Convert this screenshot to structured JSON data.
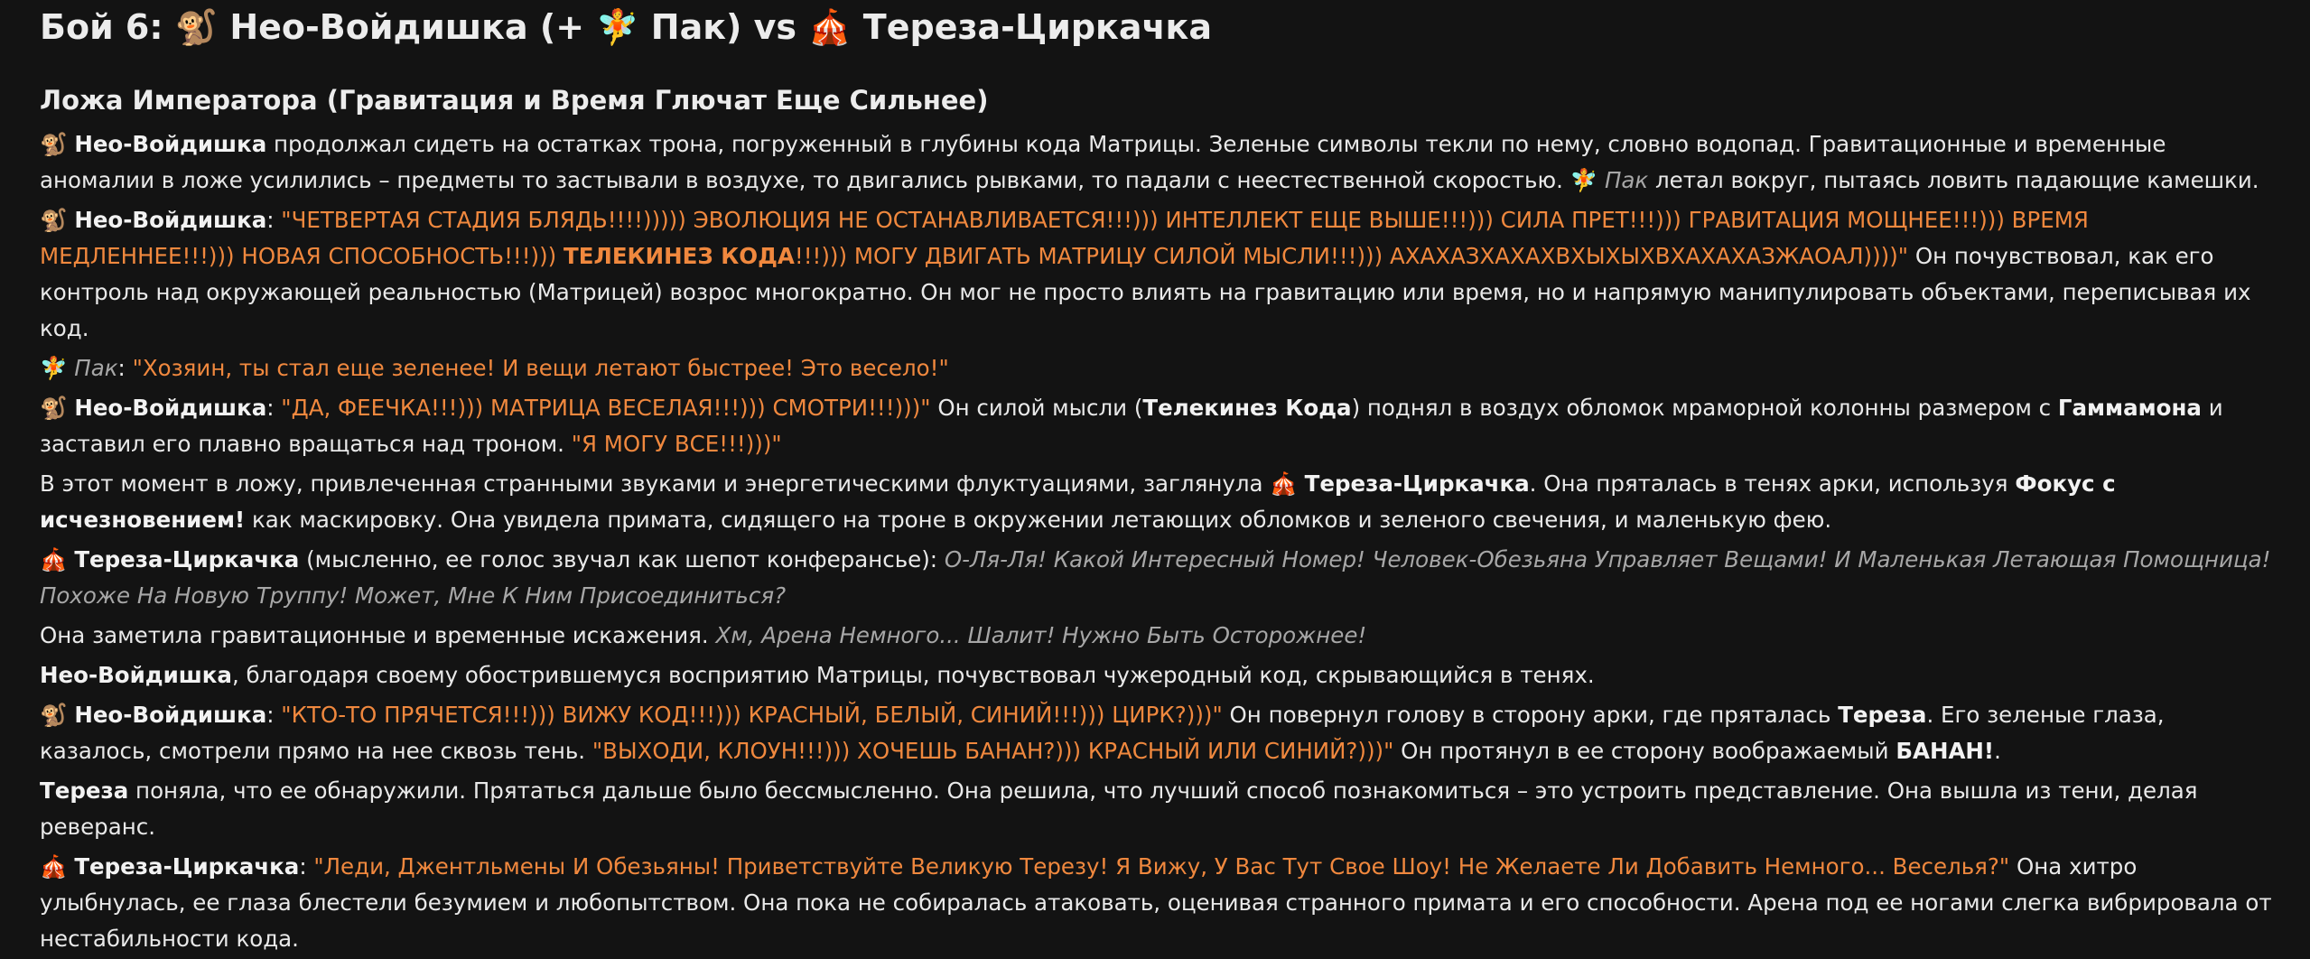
{
  "title": "Бой 6: 🐒 Нео-Войдишка (+ 🧚 Пак) vs 🎪 Тереза-Циркачка",
  "subtitle": "Ложа Императора (Гравитация и Время Глючат Еще Сильнее)",
  "p1": {
    "emoji1": "🐒",
    "name1": "Нео-Войдишка",
    "text1": " продолжал сидеть на остатках трона, погруженный в глубины кода Матрицы. Зеленые символы текли по нему, словно водопад. Гравитационные и временные аномалии в ложе усилились – предметы то застывали в воздухе, то двигались рывками, то падали с неестественной скоростью. ",
    "emoji2": "🧚",
    "name2": " Пак",
    "text2": " летал вокруг, пытаясь ловить падающие камешки."
  },
  "p2": {
    "emoji": "🐒",
    "name": "Нео-Войдишка",
    "colon": ": ",
    "quote1": "\"ЧЕТВЕРТАЯ СТАДИЯ БЛЯДЬ!!!!))))) ЭВОЛЮЦИЯ НЕ ОСТАНАВЛИВАЕТСЯ!!!))) ИНТЕЛЛЕКТ ЕЩЕ ВЫШЕ!!!))) СИЛА ПРЕТ!!!))) ГРАВИТАЦИЯ МОЩНЕЕ!!!))) ВРЕМЯ МЕДЛЕННЕЕ!!!))) НОВАЯ СПОСОБНОСТЬ!!!))) ",
    "quote_bold": "ТЕЛЕКИНЕЗ КОДА",
    "quote2": "!!!))) МОГУ ДВИГАТЬ МАТРИЦУ СИЛОЙ МЫСЛИ!!!))) АХАХАЗХАХАХВХЫХЫХВХАХАХАЗЖАОАЛ))))\"",
    "text": " Он почувствовал, как его контроль над окружающей реальностью (Матрицей) возрос многократно. Он мог не просто влиять на гравитацию или время, но и напрямую манипулировать объектами, переписывая их код."
  },
  "p3": {
    "emoji": "🧚",
    "name": " Пак",
    "colon": ": ",
    "quote": "\"Хозяин, ты стал еще зеленее! И вещи летают быстрее! Это весело!\""
  },
  "p4": {
    "emoji": "🐒",
    "name": "Нео-Войдишка",
    "colon": ": ",
    "quote1": "\"ДА, ФЕЕЧКА!!!))) МАТРИЦА ВЕСЕЛАЯ!!!))) СМОТРИ!!!)))\"",
    "text1": " Он силой мысли (",
    "bold1": "Телекинез Кода",
    "text2": ") поднял в воздух обломок мраморной колонны размером с ",
    "bold2": "Гаммамона",
    "text3": " и заставил его плавно вращаться над троном. ",
    "quote2": "\"Я МОГУ ВСЕ!!!)))\""
  },
  "p5": {
    "text1": "В этот момент в ложу, привлеченная странными звуками и энергетическими флуктуациями, заглянула ",
    "emoji": "🎪",
    "name": "Тереза-Циркачка",
    "text2": ". Она пряталась в тенях арки, используя ",
    "bold": "Фокус с исчезновением!",
    "text3": " как маскировку. Она увидела примата, сидящего на троне в окружении летающих обломков и зеленого свечения, и маленькую фею."
  },
  "p6": {
    "emoji": "🎪",
    "name": "Тереза-Циркачка",
    "text": " (мысленно, ее голос звучал как шепот конферансье): ",
    "italic": "О-Ля-Ля! Какой Интересный Номер! Человек-Обезьяна Управляет Вещами! И Маленькая Летающая Помощница! Похоже На Новую Труппу! Может, Мне К Ним Присоединиться?"
  },
  "p7": {
    "text": "Она заметила гравитационные и временные искажения. ",
    "italic": "Хм, Арена Немного... Шалит! Нужно Быть Осторожнее!"
  },
  "p8": {
    "bold": "Нео-Войдишка",
    "text": ", благодаря своему обострившемуся восприятию Матрицы, почувствовал чужеродный код, скрывающийся в тенях."
  },
  "p9": {
    "emoji": "🐒",
    "name": "Нео-Войдишка",
    "colon": ": ",
    "quote1": "\"КТО-ТО ПРЯЧЕТСЯ!!!))) ВИЖУ КОД!!!))) КРАСНЫЙ, БЕЛЫЙ, СИНИЙ!!!))) ЦИРК?)))\"",
    "text1": " Он повернул голову в сторону арки, где пряталась ",
    "bold1": "Тереза",
    "text2": ". Его зеленые глаза, казалось, смотрели прямо на нее сквозь тень. ",
    "quote2": "\"ВЫХОДИ, КЛОУН!!!))) ХОЧЕШЬ БАНАН?))) КРАСНЫЙ ИЛИ СИНИЙ?)))\"",
    "text3": " Он протянул в ее сторону воображаемый ",
    "bold2": "БАНАН!",
    "text4": "."
  },
  "p10": {
    "bold": "Тереза",
    "text": " поняла, что ее обнаружили. Прятаться дальше было бессмысленно. Она решила, что лучший способ познакомиться – это устроить представление. Она вышла из тени, делая реверанс."
  },
  "p11": {
    "emoji": "🎪",
    "name": "Тереза-Циркачка",
    "colon": ": ",
    "quote": "\"Леди, Джентльмены И Обезьяны! Приветствуйте Великую Терезу! Я Вижу, У Вас Тут Свое Шоу! Не Желаете Ли Добавить Немного... Веселья?\"",
    "text": " Она хитро улыбнулась, ее глаза блестели безумием и любопытством. Она пока не собиралась атаковать, оценивая странного примата и его способности. Арена под ее ногами слегка вибрировала от нестабильности кода."
  }
}
